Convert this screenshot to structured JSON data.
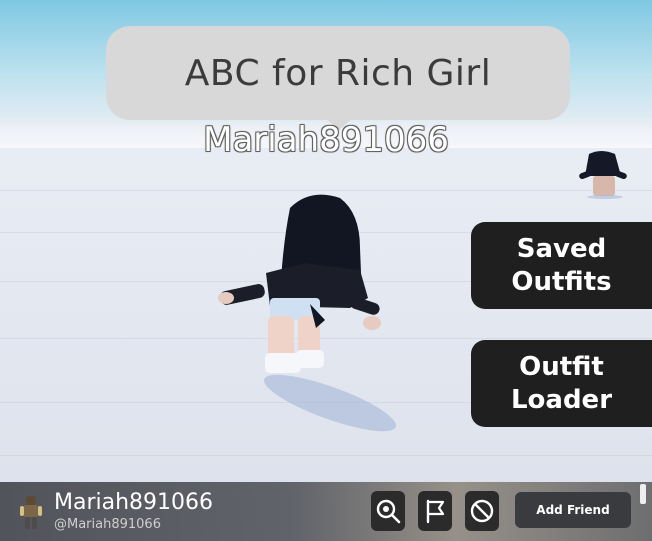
{
  "chat_bubble": {
    "text": "ABC for Rich Girl"
  },
  "nametag": {
    "text": "Mariah891066"
  },
  "side_buttons": {
    "saved_outfits": "Saved\nOutfits",
    "outfit_loader": "Outfit\nLoader"
  },
  "player_bar": {
    "display_name": "Mariah891066",
    "handle": "@Mariah891066",
    "icons": [
      "inspect-icon",
      "report-flag-icon",
      "block-icon"
    ],
    "add_friend_label": "Add Friend"
  },
  "colors": {
    "button_bg": "#1f1f1f",
    "bubble_bg": "#d8d8d8",
    "sky_top": "#7fc8e3"
  }
}
